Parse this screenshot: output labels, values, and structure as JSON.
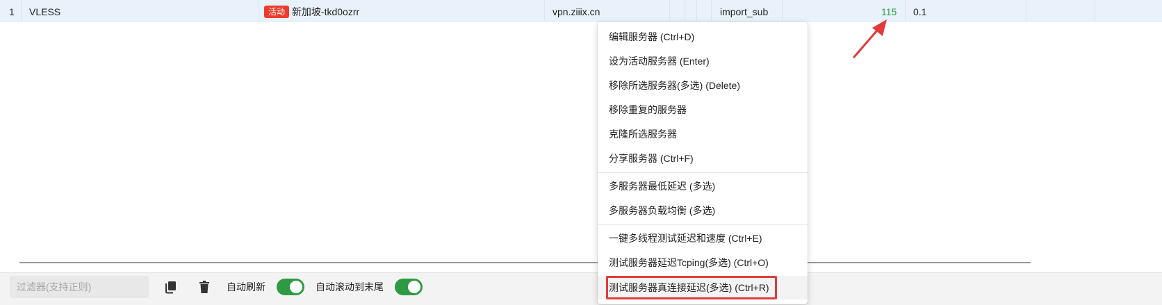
{
  "table": {
    "row": {
      "index": "1",
      "type": "VLESS",
      "badge": "活动",
      "name": "新加坡-tkd0ozrr",
      "address": "vpn.ziiix.cn",
      "sub": "import_sub",
      "delay": "115",
      "speed": "0.1"
    }
  },
  "toolbar": {
    "filter_placeholder": "过滤器(支持正则)",
    "auto_refresh_label": "自动刷新",
    "auto_refresh_on": true,
    "auto_scroll_label": "自动滚动到末尾",
    "auto_scroll_on": true
  },
  "menu": {
    "items": [
      "编辑服务器 (Ctrl+D)",
      "设为活动服务器 (Enter)",
      "移除所选服务器(多选) (Delete)",
      "移除重复的服务器",
      "克隆所选服务器",
      "分享服务器 (Ctrl+F)",
      "多服务器最低延迟 (多选)",
      "多服务器负载均衡 (多选)",
      "一键多线程测试延迟和速度 (Ctrl+E)",
      "测试服务器延迟Tcping(多选) (Ctrl+O)",
      "测试服务器真连接延迟(多选) (Ctrl+R)"
    ],
    "highlighted_index": 10
  },
  "colors": {
    "row_selected": "#e9f1fb",
    "badge": "#ee3b2b",
    "delay_good": "#2aa33c",
    "toggle_on": "#2e9b44",
    "annotation_red": "#e23a3a"
  },
  "icons": {
    "copy": "copy-icon",
    "delete": "trash-icon"
  }
}
